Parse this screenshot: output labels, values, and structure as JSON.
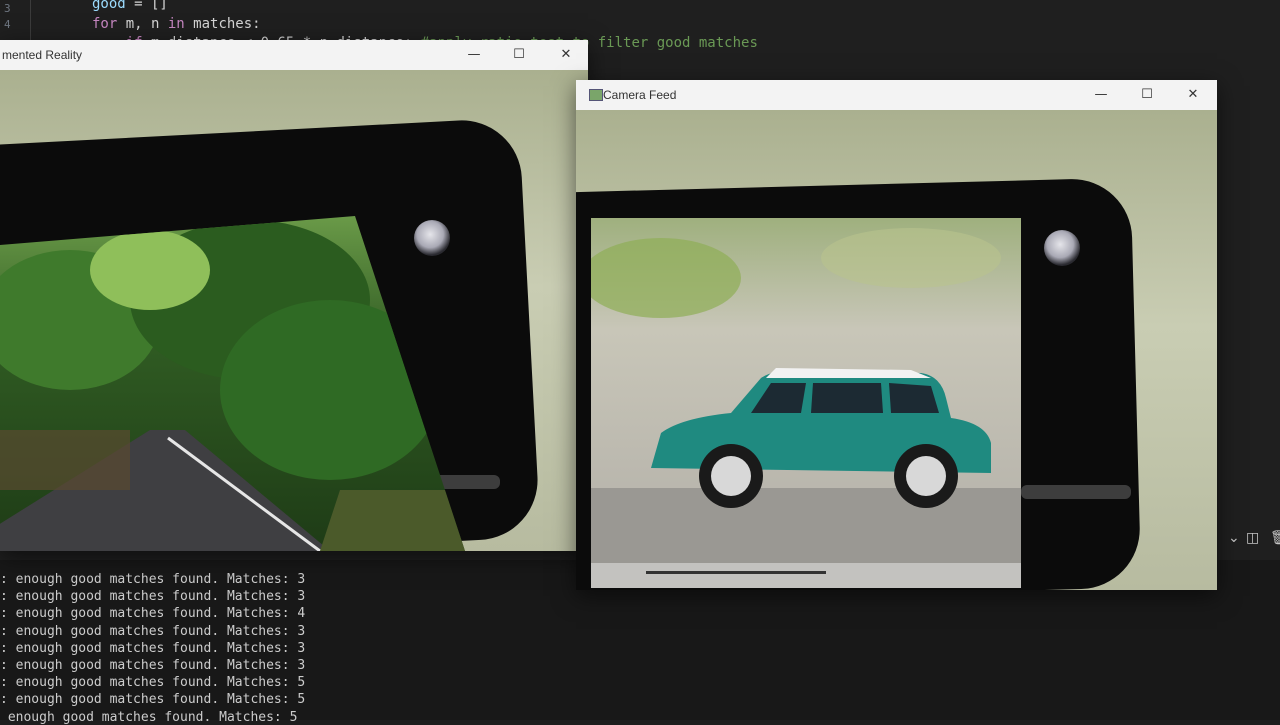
{
  "editor": {
    "line_numbers": [
      "3",
      "4"
    ],
    "code_lines": [
      {
        "parts": [
          {
            "cls": "var",
            "text": "good"
          },
          {
            "cls": "",
            "text": " = []"
          }
        ]
      },
      {
        "parts": [
          {
            "cls": "kw",
            "text": "for"
          },
          {
            "cls": "",
            "text": " m, n "
          },
          {
            "cls": "kw",
            "text": "in"
          },
          {
            "cls": "",
            "text": " matches:"
          }
        ]
      },
      {
        "parts": [
          {
            "cls": "kw",
            "text": "    if"
          },
          {
            "cls": "",
            "text": " m.distance < 0.65 * n.distance: "
          },
          {
            "cls": "cmt",
            "text": "#apply ratio test to filter good matches"
          }
        ]
      }
    ]
  },
  "terminal": {
    "lines": [
      ": enough good matches found. Matches: 3",
      ": enough good matches found. Matches: 3",
      ": enough good matches found. Matches: 4",
      ": enough good matches found. Matches: 3",
      ": enough good matches found. Matches: 3",
      ": enough good matches found. Matches: 3",
      ": enough good matches found. Matches: 5",
      ": enough good matches found. Matches: 5",
      " enough good matches found. Matches: 5"
    ],
    "toolbar_icons": [
      "chevron-down-icon",
      "split-terminal-icon",
      "trash-icon"
    ]
  },
  "ar_window": {
    "title": "mented Reality",
    "minimize": "—",
    "maximize": "☐",
    "close": "✕"
  },
  "camera_window": {
    "title": "Camera Feed",
    "minimize": "—",
    "maximize": "☐",
    "close": "✕"
  }
}
